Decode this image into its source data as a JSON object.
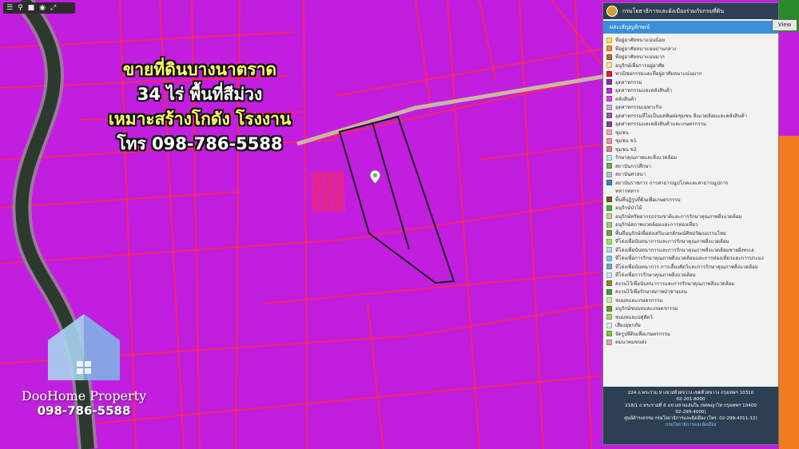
{
  "toolbar": {
    "icons": [
      "menu-icon",
      "pin-icon",
      "square-icon",
      "target-icon",
      "expand-icon"
    ]
  },
  "promo": {
    "line1": "ขายที่ดินบางนาตราด",
    "line2": "34 ไร่ พื้นที่สีม่วง",
    "line3": "เหมาะสร้างโกดัง โรงงาน",
    "line4": "โทร 098-786-5588"
  },
  "brand": {
    "name": "DooHome Property",
    "phone": "098-786-5588"
  },
  "panel": {
    "title": "กรมโยธาธิการและผังเมืองร่วมกับกรมที่ดิน",
    "tab": "ผละเสัญญลักษณ์",
    "view_button": "View",
    "legend": [
      {
        "label": "ที่อยู่อาศัยหนาแน่นน้อย",
        "color": "#f5e94a",
        "sub": false
      },
      {
        "label": "ที่อยู่อาศัยหนาแน่นปานกลาง",
        "color": "#f08c2b",
        "sub": false
      },
      {
        "label": "ที่อยู่อาศัยหนาแน่นมาก",
        "color": "#b86a2a",
        "sub": false
      },
      {
        "label": "อนุรักษ์เพื่อการอยู่อาศัย",
        "color": "#f9e39a",
        "sub": false
      },
      {
        "label": "พาณิชยกรรมและที่อยู่อาศัยหนาแน่นมาก",
        "color": "#e02020",
        "sub": false
      },
      {
        "label": "อุตสาหกรรม",
        "color": "#8a2bb8",
        "sub": false
      },
      {
        "label": "อุตสาหกรรมและคลังสินค้า",
        "color": "#b52ee0",
        "sub": false
      },
      {
        "label": "คลังสินค้า",
        "color": "#e040e8",
        "sub": false
      },
      {
        "label": "อุตสาหกรรมเฉพาะกิจ",
        "color": "#c9a6e8",
        "sub": false
      },
      {
        "label": "อุตสาหกรรมที่ไม่เป็นมลพิษต่อชุมชน สิ่งแวดล้อมและคลังสินค้า",
        "color": "#9b59b6",
        "sub": false
      },
      {
        "label": "อุตสาหกรรมและคลังสินค้าและเกษตรกรรม",
        "color": "#7d4a9e",
        "sub": false
      },
      {
        "label": "ชุมชน",
        "color": "#f4a7b9",
        "sub": false
      },
      {
        "label": "ชุมชน ช1",
        "color": "#f28fa8",
        "sub": false
      },
      {
        "label": "ชุมชน ช2",
        "color": "#ee7a96",
        "sub": false
      },
      {
        "label": "รักษาคุณภาพและสิ่งแวดล้อม",
        "color": "#b3e6f5",
        "sub": false
      },
      {
        "label": "สถาบันการศึกษา",
        "color": "#6ab04c",
        "sub": false
      },
      {
        "label": "สถาบันศาสนา",
        "color": "#bdbdbd",
        "sub": false
      },
      {
        "label": "สถาบันราชการ การสาธารณูปโภคและสาธารณูปการ",
        "color": "#3a7fd5",
        "sub": false
      },
      {
        "label": "ทหารทหาร",
        "color": "",
        "sub": true
      },
      {
        "label": "พื้นที่ปฏิรูปที่ดินเพื่อเกษตรกรรม",
        "color": "#7a5a1e",
        "sub": false
      },
      {
        "label": "อนุรักษ์ป่าไม้",
        "color": "#3fb83a",
        "sub": false
      },
      {
        "label": "อนุรักษ์ทรัพยากรธรรมชาติและการรักษาคุณภาพสิ่งแวดล้อม",
        "color": "#d8c7a0",
        "sub": false
      },
      {
        "label": "อนุรักษ์สภาพแวดล้อมและการท่องเที่ยว",
        "color": "#9ad07a",
        "sub": false
      },
      {
        "label": "พื้นที่อนุรักษ์เพื่อส่งเสริมเอกลักษณ์ศิลปวัฒนธรรมไทย",
        "color": "#8a9a3a",
        "sub": false
      },
      {
        "label": "ที่โล่งเพื่อนันทนาการและการรักษาคุณภาพสิ่งแวดล้อม",
        "color": "#9be36a",
        "sub": false
      },
      {
        "label": "ที่โล่งเพื่อนันทนาการและการรักษาคุณภาพสิ่งแวดล้อมชายฝั่งทะเล",
        "color": "#a9d8ef",
        "sub": false
      },
      {
        "label": "ที่โล่งเพื่อการรักษาคุณภาพสิ่งแวดล้อมและการท่องเที่ยวและการประมง",
        "color": "#7fc4e8",
        "sub": false
      },
      {
        "label": "ที่โล่งเพื่อนันทนาการ การเลี้ยงสัตว์และการรักษาคุณภาพสิ่งแวดล้อม",
        "color": "#5fb0df",
        "sub": false
      },
      {
        "label": "ที่โล่งเพื่อการรักษาคุณภาพสิ่งแวดล้อม",
        "color": "#c8e9f7",
        "sub": false
      },
      {
        "label": "สงวนไว้เพื่อนันทนาการและการรักษาคุณภาพสิ่งแวดล้อม",
        "color": "#8c8c2a",
        "sub": false
      },
      {
        "label": "สงวนไว้เพื่อรักษาสภาพป่าชายเลน",
        "color": "#4a9a3a",
        "sub": false
      },
      {
        "label": "ชนบทและเกษตรกรรม",
        "color": "#cfe7a7",
        "sub": false
      },
      {
        "label": "อนุรักษ์ชนบทและเกษตรกรรม",
        "color": "#6a9a2a",
        "sub": false
      },
      {
        "label": "ชนบทและปศุสัตว์",
        "color": "#b8c96a",
        "sub": false
      },
      {
        "label": "เสี่ยงอุทกภัย",
        "color": "#d7eaf5",
        "sub": false
      },
      {
        "label": "จัดรูปที่ดินเพื่อเกษตรกรรม",
        "color": "#7fc24a",
        "sub": false
      },
      {
        "label": "คมนาคมขนส่ง",
        "color": "#e8a3b0",
        "sub": false
      }
    ],
    "footer": [
      "224 ถ.พระราม 9 แขวงห้วยขวาง เขตห้วยขวาง กรุงเทพฯ 10310",
      "02-201-8000",
      "218/1 ถ.พระรามที่ 6 แขวงสามเสนใน เขตพญาไท กรุงเทพฯ 10400",
      "02-299-4000)",
      "ศูนย์ดำรงธรรม กรมโยธาธิการและผังเมือง (โทร. 02-299-4311-12)",
      "กรมโยธาธิการและผังเมือง"
    ]
  },
  "map": {
    "zone_color": "#c21ee0",
    "road_color": "#ff2a4a",
    "river_color": "#2c3a2e",
    "river_bank_color": "#7cc46a",
    "orange_zone_color": "#f07c1e",
    "plot_outline_color": "#1a1a1a"
  }
}
